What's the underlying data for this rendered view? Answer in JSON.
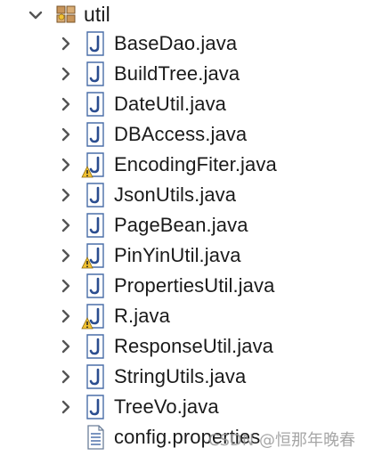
{
  "root": {
    "label": "util",
    "expanded": true,
    "icon": "package-icon"
  },
  "items": [
    {
      "label": "BaseDao.java",
      "icon": "java-file-icon",
      "warning": false
    },
    {
      "label": "BuildTree.java",
      "icon": "java-file-icon",
      "warning": false
    },
    {
      "label": "DateUtil.java",
      "icon": "java-file-icon",
      "warning": false
    },
    {
      "label": "DBAccess.java",
      "icon": "java-file-icon",
      "warning": false
    },
    {
      "label": "EncodingFiter.java",
      "icon": "java-file-icon",
      "warning": true
    },
    {
      "label": "JsonUtils.java",
      "icon": "java-file-icon",
      "warning": false
    },
    {
      "label": "PageBean.java",
      "icon": "java-file-icon",
      "warning": false
    },
    {
      "label": "PinYinUtil.java",
      "icon": "java-file-icon",
      "warning": true
    },
    {
      "label": "PropertiesUtil.java",
      "icon": "java-file-icon",
      "warning": false
    },
    {
      "label": "R.java",
      "icon": "java-file-icon",
      "warning": true
    },
    {
      "label": "ResponseUtil.java",
      "icon": "java-file-icon",
      "warning": false
    },
    {
      "label": "StringUtils.java",
      "icon": "java-file-icon",
      "warning": false
    },
    {
      "label": "TreeVo.java",
      "icon": "java-file-icon",
      "warning": false
    },
    {
      "label": "config.properties",
      "icon": "properties-file-icon",
      "warning": false
    }
  ],
  "watermark": "CSDN @恒那年晚春",
  "colors": {
    "java_icon_border": "#4a6ea9",
    "java_icon_letter": "#2b4d8f",
    "warning_fill": "#f2c231",
    "chevron": "#555555"
  }
}
